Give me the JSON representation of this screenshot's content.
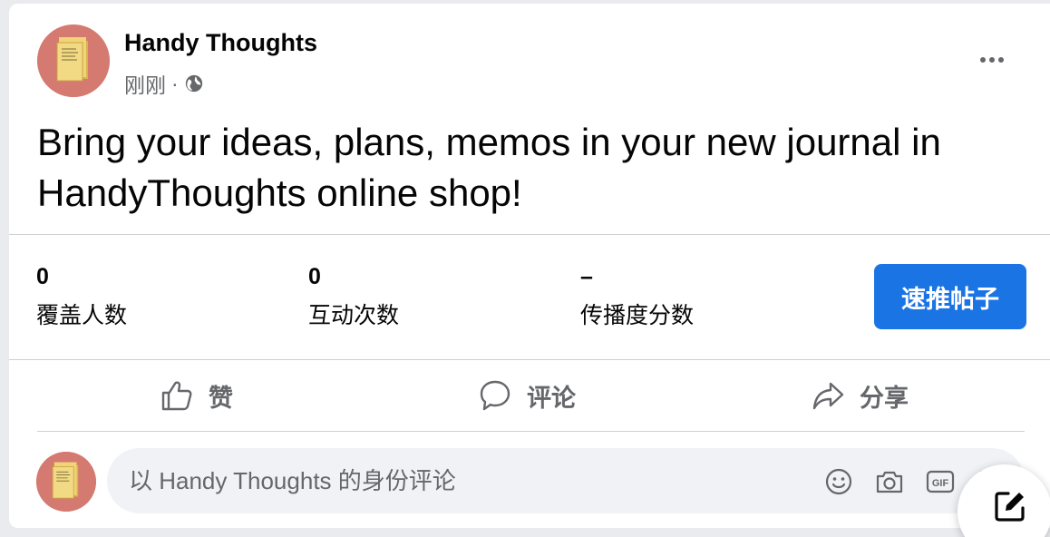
{
  "post": {
    "page_name": "Handy Thoughts",
    "timestamp": "刚刚",
    "separator": "·",
    "visibility_icon": "globe-icon",
    "more_icon": "more-options-icon",
    "text": "Bring your ideas, plans, memos in your new journal in HandyThoughts online shop!"
  },
  "insights": {
    "reach": {
      "value": "0",
      "label": "覆盖人数"
    },
    "engagement": {
      "value": "0",
      "label": "互动次数"
    },
    "distribution": {
      "value": "–",
      "label": "传播度分数"
    },
    "boost_label": "速推帖子"
  },
  "actions": {
    "like": {
      "label": "赞",
      "icon": "thumbs-up-icon"
    },
    "comment": {
      "label": "评论",
      "icon": "comment-icon"
    },
    "share": {
      "label": "分享",
      "icon": "share-icon"
    }
  },
  "comment_composer": {
    "placeholder": "以 Handy Thoughts 的身份评论",
    "icons": [
      "emoji-icon",
      "camera-icon",
      "gif-icon",
      "sticker-icon"
    ]
  },
  "compose_icon": "compose-icon",
  "colors": {
    "accent": "#1b74e4",
    "secondary_text": "#65676b",
    "avatar_bg": "#d47a70"
  }
}
